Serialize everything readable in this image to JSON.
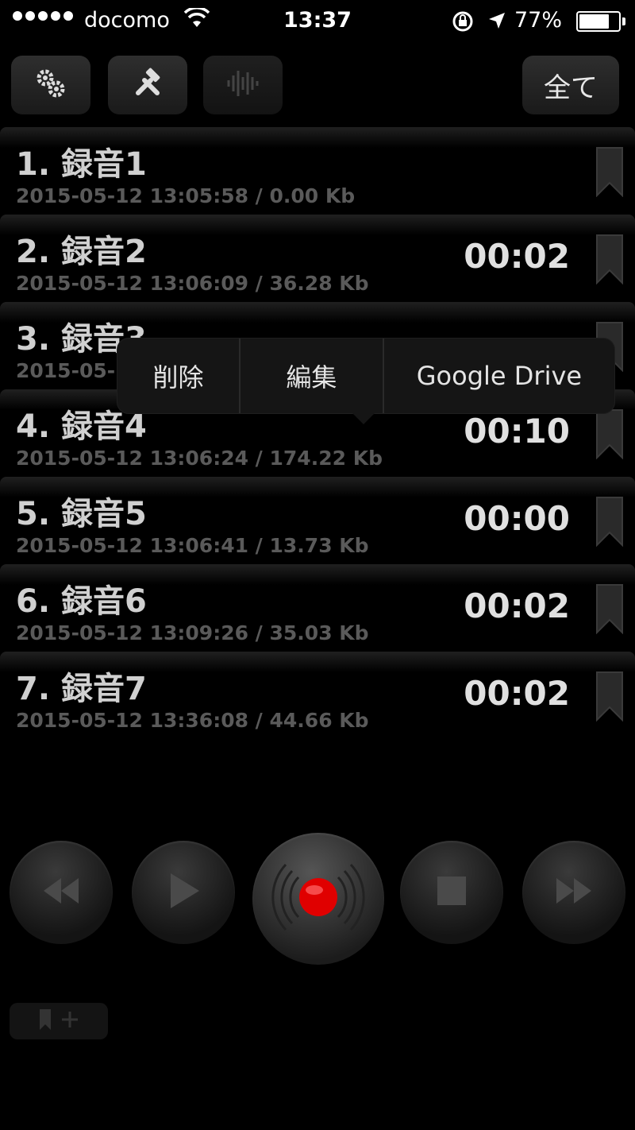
{
  "status_bar": {
    "carrier": "docomo",
    "time": "13:37",
    "battery": "77%",
    "battery_level": 0.77,
    "icons": [
      "signal-dots-icon",
      "wifi-icon",
      "rotation-lock-icon",
      "location-arrow-icon",
      "battery-icon"
    ]
  },
  "toolbar": {
    "buttons": [
      {
        "name": "settings",
        "icon": "gears-icon"
      },
      {
        "name": "tools",
        "icon": "hammer-icon"
      },
      {
        "name": "waveform",
        "icon": "waveform-icon"
      }
    ],
    "all_label": "全て"
  },
  "recordings": [
    {
      "title": "1. 録音1",
      "meta": "2015-05-12 13:05:58 / 0.00 Kb",
      "duration": ""
    },
    {
      "title": "2. 録音2",
      "meta": "2015-05-12 13:06:09 / 36.28 Kb",
      "duration": "00:02"
    },
    {
      "title": "3. 録音3",
      "meta": "2015-05-",
      "duration": ""
    },
    {
      "title": "4. 録音4",
      "meta": "2015-05-12 13:06:24 / 174.22 Kb",
      "duration": "00:10"
    },
    {
      "title": "5. 録音5",
      "meta": "2015-05-12 13:06:41 / 13.73 Kb",
      "duration": "00:00"
    },
    {
      "title": "6. 録音6",
      "meta": "2015-05-12 13:09:26 / 35.03 Kb",
      "duration": "00:02"
    },
    {
      "title": "7. 録音7",
      "meta": "2015-05-12 13:36:08 / 44.66 Kb",
      "duration": "00:02"
    }
  ],
  "popup_menu": {
    "delete": "削除",
    "edit": "編集",
    "google_drive": "Google Drive"
  },
  "controls": {
    "icons": [
      "rewind-icon",
      "play-icon",
      "record-icon",
      "stop-icon",
      "fast-forward-icon"
    ],
    "record_color": "#e00000"
  },
  "bookmark_add": {
    "icon": "bookmark-plus-icon"
  },
  "colors": {
    "background": "#000000",
    "record": "#e00000"
  }
}
